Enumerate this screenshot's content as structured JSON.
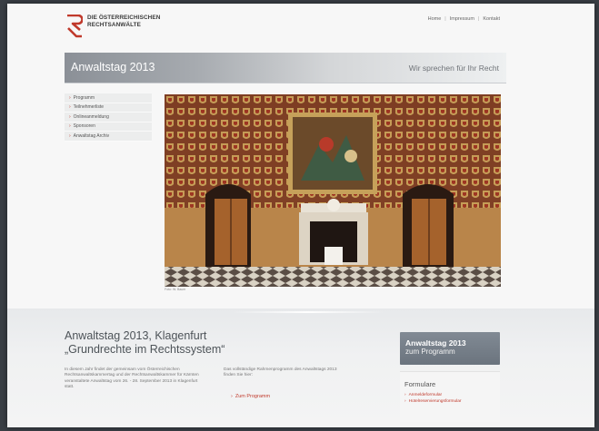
{
  "header": {
    "logo_line1": "DIE ÖSTERREICHISCHEN",
    "logo_line2": "RECHTSANWÄLTE",
    "nav": [
      "Home",
      "Impressum",
      "Kontakt"
    ],
    "nav_separator": "|"
  },
  "band": {
    "title": "Anwaltstag 2013",
    "slogan": "Wir sprechen für Ihr Recht"
  },
  "sidebar": {
    "items": [
      {
        "label": "Programm"
      },
      {
        "label": "Teilnehmerliste"
      },
      {
        "label": "Onlineanmeldung"
      },
      {
        "label": "Sponsoren"
      },
      {
        "label": "Anwaltstag Archiv"
      }
    ]
  },
  "hero": {
    "caption": "Foto: W. Bauer"
  },
  "main": {
    "headline_line1": "Anwaltstag 2013, Klagenfurt",
    "headline_line2": "„Grundrechte im Rechtssystem“",
    "intro": "In diesem Jahr findet der gemeinsam vom Österreichischen Rechtsanwaltskammertag und der Rechtsanwaltskammer für Kärnten veranstaltete Anwaltstag vom 26. - 28. September 2013 in Klagenfurt statt.",
    "program_text": "Das vollständige Rahmenprogramm des Anwaltstags 2013 finden Sie hier:",
    "program_link": "Zum Programm"
  },
  "aside": {
    "cta_line1": "Anwaltstag 2013",
    "cta_line2": "zum Programm",
    "forms_title": "Formulare",
    "forms": [
      {
        "label": "Anmeldeformular"
      },
      {
        "label": "Hotelreservierungsformular"
      }
    ]
  },
  "colors": {
    "accent": "#c0392b",
    "band_dark": "#8b9097",
    "cta": "#737c86"
  },
  "icons": {
    "logo": "logo-mark-icon",
    "bullet": "chevron-right-icon"
  }
}
